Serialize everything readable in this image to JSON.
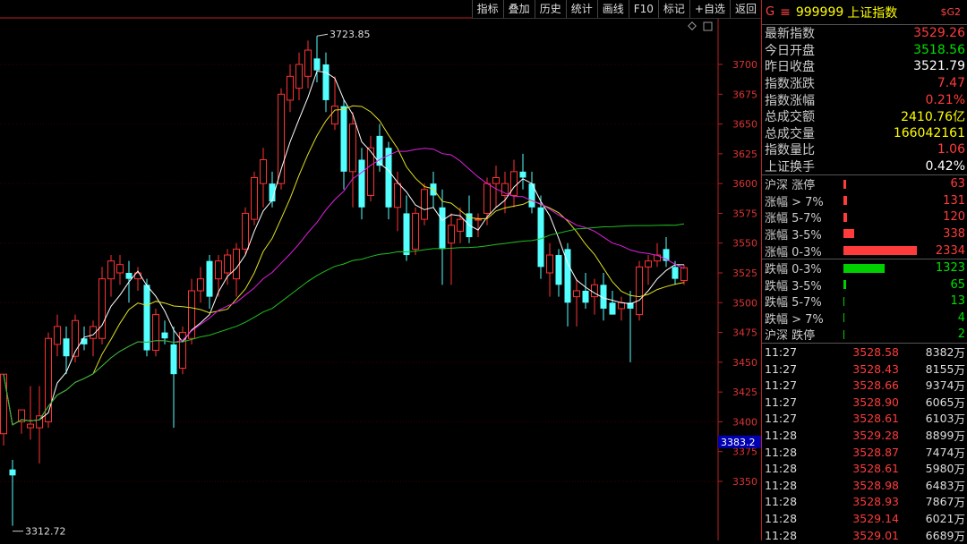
{
  "toolbar": {
    "items": [
      "指标",
      "叠加",
      "历史",
      "统计",
      "画线",
      "F10",
      "标记",
      "+自选",
      "返回"
    ]
  },
  "header": {
    "g_label": "G",
    "menu_glyph": "≡",
    "code": "999999",
    "name": "上证指数",
    "badge": "$G2"
  },
  "quote": [
    {
      "label": "最新指数",
      "value": "3529.26",
      "color": "red"
    },
    {
      "label": "今日开盘",
      "value": "3518.56",
      "color": "green"
    },
    {
      "label": "昨日收盘",
      "value": "3521.79",
      "color": "white"
    },
    {
      "label": "指数涨跌",
      "value": "7.47",
      "color": "red"
    },
    {
      "label": "指数涨幅",
      "value": "0.21%",
      "color": "red"
    },
    {
      "label": "总成交额",
      "value": "2410.76亿",
      "color": "yellow"
    },
    {
      "label": "总成交量",
      "value": "166042161",
      "color": "yellow"
    },
    {
      "label": "指数量比",
      "value": "1.06",
      "color": "red"
    },
    {
      "label": "上证换手",
      "value": "0.42%",
      "color": "white"
    }
  ],
  "breadth_up": [
    {
      "label": "沪深 涨停",
      "value": "63"
    },
    {
      "label": "涨幅 > 7%",
      "value": "131"
    },
    {
      "label": "涨幅 5-7%",
      "value": "120"
    },
    {
      "label": "涨幅 3-5%",
      "value": "338"
    },
    {
      "label": "涨幅 0-3%",
      "value": "2334"
    }
  ],
  "breadth_down": [
    {
      "label": "跌幅 0-3%",
      "value": "1323"
    },
    {
      "label": "跌幅 3-5%",
      "value": "65"
    },
    {
      "label": "跌幅 5-7%",
      "value": "13"
    },
    {
      "label": "跌幅 > 7%",
      "value": "4"
    },
    {
      "label": "沪深 跌停",
      "value": "2"
    }
  ],
  "ticks": [
    {
      "time": "11:27",
      "price": "3528.58",
      "vol": "8382",
      "unit": "万"
    },
    {
      "time": "11:27",
      "price": "3528.43",
      "vol": "8155",
      "unit": "万"
    },
    {
      "time": "11:27",
      "price": "3528.66",
      "vol": "9374",
      "unit": "万"
    },
    {
      "time": "11:27",
      "price": "3528.90",
      "vol": "6065",
      "unit": "万"
    },
    {
      "time": "11:27",
      "price": "3528.61",
      "vol": "6103",
      "unit": "万"
    },
    {
      "time": "11:28",
      "price": "3529.28",
      "vol": "8899",
      "unit": "万"
    },
    {
      "time": "11:28",
      "price": "3528.87",
      "vol": "7474",
      "unit": "万"
    },
    {
      "time": "11:28",
      "price": "3528.61",
      "vol": "5980",
      "unit": "万"
    },
    {
      "time": "11:28",
      "price": "3528.98",
      "vol": "6483",
      "unit": "万"
    },
    {
      "time": "11:28",
      "price": "3528.93",
      "vol": "7867",
      "unit": "万"
    },
    {
      "time": "11:28",
      "price": "3529.14",
      "vol": "6021",
      "unit": "万"
    },
    {
      "time": "11:28",
      "price": "3529.01",
      "vol": "6689",
      "unit": "万"
    }
  ],
  "chart_data": {
    "type": "candlestick",
    "y_ticks": [
      3350,
      3375,
      3400,
      3425,
      3450,
      3475,
      3500,
      3525,
      3550,
      3575,
      3600,
      3625,
      3650,
      3675,
      3700
    ],
    "ylim": [
      3305,
      3735
    ],
    "high_label": "3723.85",
    "low_label": "3312.72",
    "price_marker": "3383.2",
    "candles": [
      {
        "o": 3390,
        "h": 3440,
        "l": 3380,
        "c": 3440
      },
      {
        "o": 3360,
        "h": 3368,
        "l": 3312.72,
        "c": 3355
      },
      {
        "o": 3400,
        "h": 3410,
        "l": 3390,
        "c": 3410
      },
      {
        "o": 3395,
        "h": 3430,
        "l": 3385,
        "c": 3398
      },
      {
        "o": 3395,
        "h": 3430,
        "l": 3365,
        "c": 3405
      },
      {
        "o": 3400,
        "h": 3475,
        "l": 3395,
        "c": 3470
      },
      {
        "o": 3465,
        "h": 3490,
        "l": 3455,
        "c": 3480
      },
      {
        "o": 3470,
        "h": 3480,
        "l": 3440,
        "c": 3455
      },
      {
        "o": 3455,
        "h": 3490,
        "l": 3450,
        "c": 3485
      },
      {
        "o": 3470,
        "h": 3480,
        "l": 3460,
        "c": 3465
      },
      {
        "o": 3470,
        "h": 3485,
        "l": 3455,
        "c": 3480
      },
      {
        "o": 3470,
        "h": 3530,
        "l": 3465,
        "c": 3520
      },
      {
        "o": 3520,
        "h": 3540,
        "l": 3505,
        "c": 3535
      },
      {
        "o": 3525,
        "h": 3540,
        "l": 3515,
        "c": 3532
      },
      {
        "o": 3525,
        "h": 3535,
        "l": 3500,
        "c": 3520
      },
      {
        "o": 3520,
        "h": 3530,
        "l": 3510,
        "c": 3525
      },
      {
        "o": 3515,
        "h": 3520,
        "l": 3455,
        "c": 3460
      },
      {
        "o": 3460,
        "h": 3495,
        "l": 3455,
        "c": 3490
      },
      {
        "o": 3475,
        "h": 3485,
        "l": 3465,
        "c": 3470
      },
      {
        "o": 3465,
        "h": 3480,
        "l": 3395,
        "c": 3440
      },
      {
        "o": 3445,
        "h": 3480,
        "l": 3440,
        "c": 3475
      },
      {
        "o": 3470,
        "h": 3520,
        "l": 3465,
        "c": 3510
      },
      {
        "o": 3510,
        "h": 3530,
        "l": 3500,
        "c": 3520
      },
      {
        "o": 3535,
        "h": 3540,
        "l": 3495,
        "c": 3505
      },
      {
        "o": 3520,
        "h": 3540,
        "l": 3505,
        "c": 3535
      },
      {
        "o": 3525,
        "h": 3545,
        "l": 3515,
        "c": 3540
      },
      {
        "o": 3520,
        "h": 3550,
        "l": 3505,
        "c": 3545
      },
      {
        "o": 3545,
        "h": 3580,
        "l": 3540,
        "c": 3575
      },
      {
        "o": 3570,
        "h": 3610,
        "l": 3565,
        "c": 3605
      },
      {
        "o": 3600,
        "h": 3630,
        "l": 3580,
        "c": 3620
      },
      {
        "o": 3600,
        "h": 3610,
        "l": 3580,
        "c": 3585
      },
      {
        "o": 3600,
        "h": 3680,
        "l": 3595,
        "c": 3675
      },
      {
        "o": 3670,
        "h": 3700,
        "l": 3660,
        "c": 3690
      },
      {
        "o": 3680,
        "h": 3710,
        "l": 3670,
        "c": 3700
      },
      {
        "o": 3690,
        "h": 3720,
        "l": 3680,
        "c": 3712
      },
      {
        "o": 3705,
        "h": 3723.85,
        "l": 3685,
        "c": 3695
      },
      {
        "o": 3700,
        "h": 3710,
        "l": 3660,
        "c": 3670
      },
      {
        "o": 3650,
        "h": 3690,
        "l": 3645,
        "c": 3665
      },
      {
        "o": 3665,
        "h": 3670,
        "l": 3595,
        "c": 3610
      },
      {
        "o": 3610,
        "h": 3660,
        "l": 3580,
        "c": 3650
      },
      {
        "o": 3620,
        "h": 3630,
        "l": 3570,
        "c": 3580
      },
      {
        "o": 3590,
        "h": 3640,
        "l": 3585,
        "c": 3630
      },
      {
        "o": 3640,
        "h": 3650,
        "l": 3610,
        "c": 3615
      },
      {
        "o": 3630,
        "h": 3635,
        "l": 3570,
        "c": 3580
      },
      {
        "o": 3580,
        "h": 3610,
        "l": 3560,
        "c": 3600
      },
      {
        "o": 3575,
        "h": 3590,
        "l": 3535,
        "c": 3540
      },
      {
        "o": 3545,
        "h": 3580,
        "l": 3540,
        "c": 3575
      },
      {
        "o": 3570,
        "h": 3600,
        "l": 3565,
        "c": 3595
      },
      {
        "o": 3600,
        "h": 3610,
        "l": 3580,
        "c": 3590
      },
      {
        "o": 3580,
        "h": 3595,
        "l": 3515,
        "c": 3545
      },
      {
        "o": 3550,
        "h": 3575,
        "l": 3515,
        "c": 3565
      },
      {
        "o": 3560,
        "h": 3580,
        "l": 3550,
        "c": 3570
      },
      {
        "o": 3575,
        "h": 3590,
        "l": 3550,
        "c": 3555
      },
      {
        "o": 3570,
        "h": 3575,
        "l": 3555,
        "c": 3570
      },
      {
        "o": 3575,
        "h": 3605,
        "l": 3565,
        "c": 3600
      },
      {
        "o": 3600,
        "h": 3615,
        "l": 3580,
        "c": 3605
      },
      {
        "o": 3590,
        "h": 3610,
        "l": 3575,
        "c": 3600
      },
      {
        "o": 3590,
        "h": 3620,
        "l": 3580,
        "c": 3610
      },
      {
        "o": 3610,
        "h": 3625,
        "l": 3595,
        "c": 3605
      },
      {
        "o": 3600,
        "h": 3610,
        "l": 3575,
        "c": 3580
      },
      {
        "o": 3580,
        "h": 3590,
        "l": 3520,
        "c": 3530
      },
      {
        "o": 3525,
        "h": 3550,
        "l": 3505,
        "c": 3540
      },
      {
        "o": 3540,
        "h": 3545,
        "l": 3505,
        "c": 3515
      },
      {
        "o": 3545,
        "h": 3550,
        "l": 3480,
        "c": 3500
      },
      {
        "o": 3505,
        "h": 3520,
        "l": 3480,
        "c": 3510
      },
      {
        "o": 3510,
        "h": 3525,
        "l": 3495,
        "c": 3500
      },
      {
        "o": 3505,
        "h": 3520,
        "l": 3490,
        "c": 3515
      },
      {
        "o": 3515,
        "h": 3525,
        "l": 3485,
        "c": 3495
      },
      {
        "o": 3500,
        "h": 3510,
        "l": 3490,
        "c": 3490
      },
      {
        "o": 3495,
        "h": 3505,
        "l": 3485,
        "c": 3500
      },
      {
        "o": 3500,
        "h": 3510,
        "l": 3450,
        "c": 3495
      },
      {
        "o": 3490,
        "h": 3535,
        "l": 3485,
        "c": 3530
      },
      {
        "o": 3530,
        "h": 3540,
        "l": 3515,
        "c": 3535
      },
      {
        "o": 3535,
        "h": 3550,
        "l": 3530,
        "c": 3540
      },
      {
        "o": 3545,
        "h": 3555,
        "l": 3530,
        "c": 3535
      },
      {
        "o": 3530,
        "h": 3535,
        "l": 3515,
        "c": 3520
      },
      {
        "o": 3518.56,
        "h": 3532,
        "l": 3515,
        "c": 3529.26
      }
    ]
  }
}
